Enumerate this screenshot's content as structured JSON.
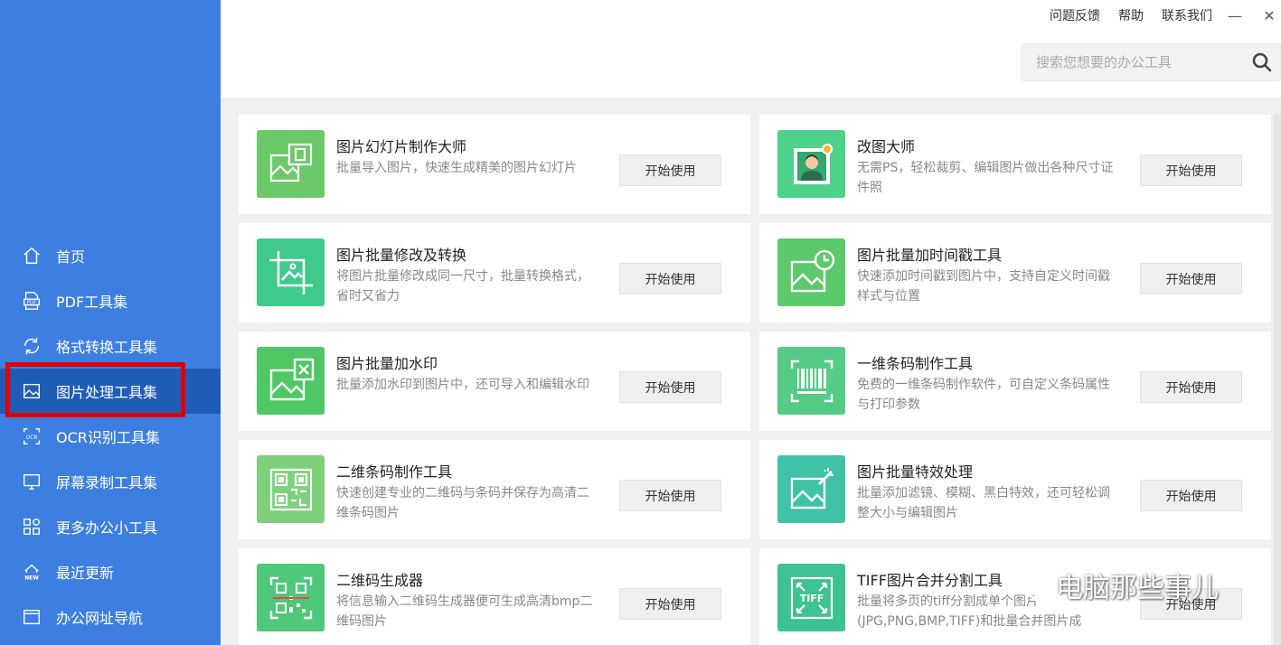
{
  "window": {
    "top_links": [
      "问题反馈",
      "帮助",
      "联系我们"
    ],
    "minimize": "—",
    "close": "✕"
  },
  "search": {
    "placeholder": "搜索您想要的办公工具"
  },
  "sidebar": {
    "items": [
      {
        "label": "首页",
        "icon": "home-icon"
      },
      {
        "label": "PDF工具集",
        "icon": "pdf-icon"
      },
      {
        "label": "格式转换工具集",
        "icon": "refresh-icon"
      },
      {
        "label": "图片处理工具集",
        "icon": "image-icon",
        "active": true
      },
      {
        "label": "OCR识别工具集",
        "icon": "ocr-icon"
      },
      {
        "label": "屏幕录制工具集",
        "icon": "monitor-icon"
      },
      {
        "label": "更多办公小工具",
        "icon": "grid-icon"
      },
      {
        "label": "最近更新",
        "icon": "new-icon"
      },
      {
        "label": "办公网址导航",
        "icon": "browser-icon"
      }
    ]
  },
  "tools": [
    {
      "title": "图片幻灯片制作大师",
      "desc": "批量导入图片，快速生成精美的图片幻灯片",
      "button": "开始使用",
      "icon": "slideshow-icon",
      "color": "#6cc96a"
    },
    {
      "title": "改图大师",
      "desc": "无需PS，轻松裁剪、编辑图片做出各种尺寸证件照",
      "button": "开始使用",
      "icon": "portrait-icon",
      "color": "#4cd28a"
    },
    {
      "title": "图片批量修改及转换",
      "desc": "将图片批量修改成同一尺寸，批量转换格式，省时又省力",
      "button": "开始使用",
      "icon": "crop-icon",
      "color": "#3fc98a"
    },
    {
      "title": "图片批量加时间戳工具",
      "desc": "快速添加时间戳到图片中，支持自定义时间戳样式与位置",
      "button": "开始使用",
      "icon": "clock-image-icon",
      "color": "#5cc96d"
    },
    {
      "title": "图片批量加水印",
      "desc": "批量添加水印到图片中，还可导入和编辑水印",
      "button": "开始使用",
      "icon": "watermark-icon",
      "color": "#4fc765"
    },
    {
      "title": "一维条码制作工具",
      "desc": "免费的一维条码制作软件，可自定义条码属性与打印参数",
      "button": "开始使用",
      "icon": "barcode-icon",
      "color": "#55cc85"
    },
    {
      "title": "二维条码制作工具",
      "desc": "快速创建专业的二维码与条码并保存为高清二维条码图片",
      "button": "开始使用",
      "icon": "qrcode-icon",
      "color": "#7ed07a"
    },
    {
      "title": "图片批量特效处理",
      "desc": "批量添加滤镜、模糊、黑白特效，还可轻松调整大小与编辑图片",
      "button": "开始使用",
      "icon": "magic-image-icon",
      "color": "#3fc2a6"
    },
    {
      "title": "二维码生成器",
      "desc": "将信息输入二维码生成器便可生成高清bmp二维码图片",
      "button": "开始使用",
      "icon": "qr-generator-icon",
      "color": "#50c87a"
    },
    {
      "title": "TIFF图片合并分割工具",
      "desc": "批量将多页的tiff分割成单个图片(JPG,PNG,BMP,TIFF)和批量合并图片成",
      "button": "开始使用",
      "icon": "tiff-icon",
      "color": "#3fc292"
    }
  ],
  "watermark": {
    "text": "电脑那些事儿",
    "icon": "wechat-icon"
  }
}
